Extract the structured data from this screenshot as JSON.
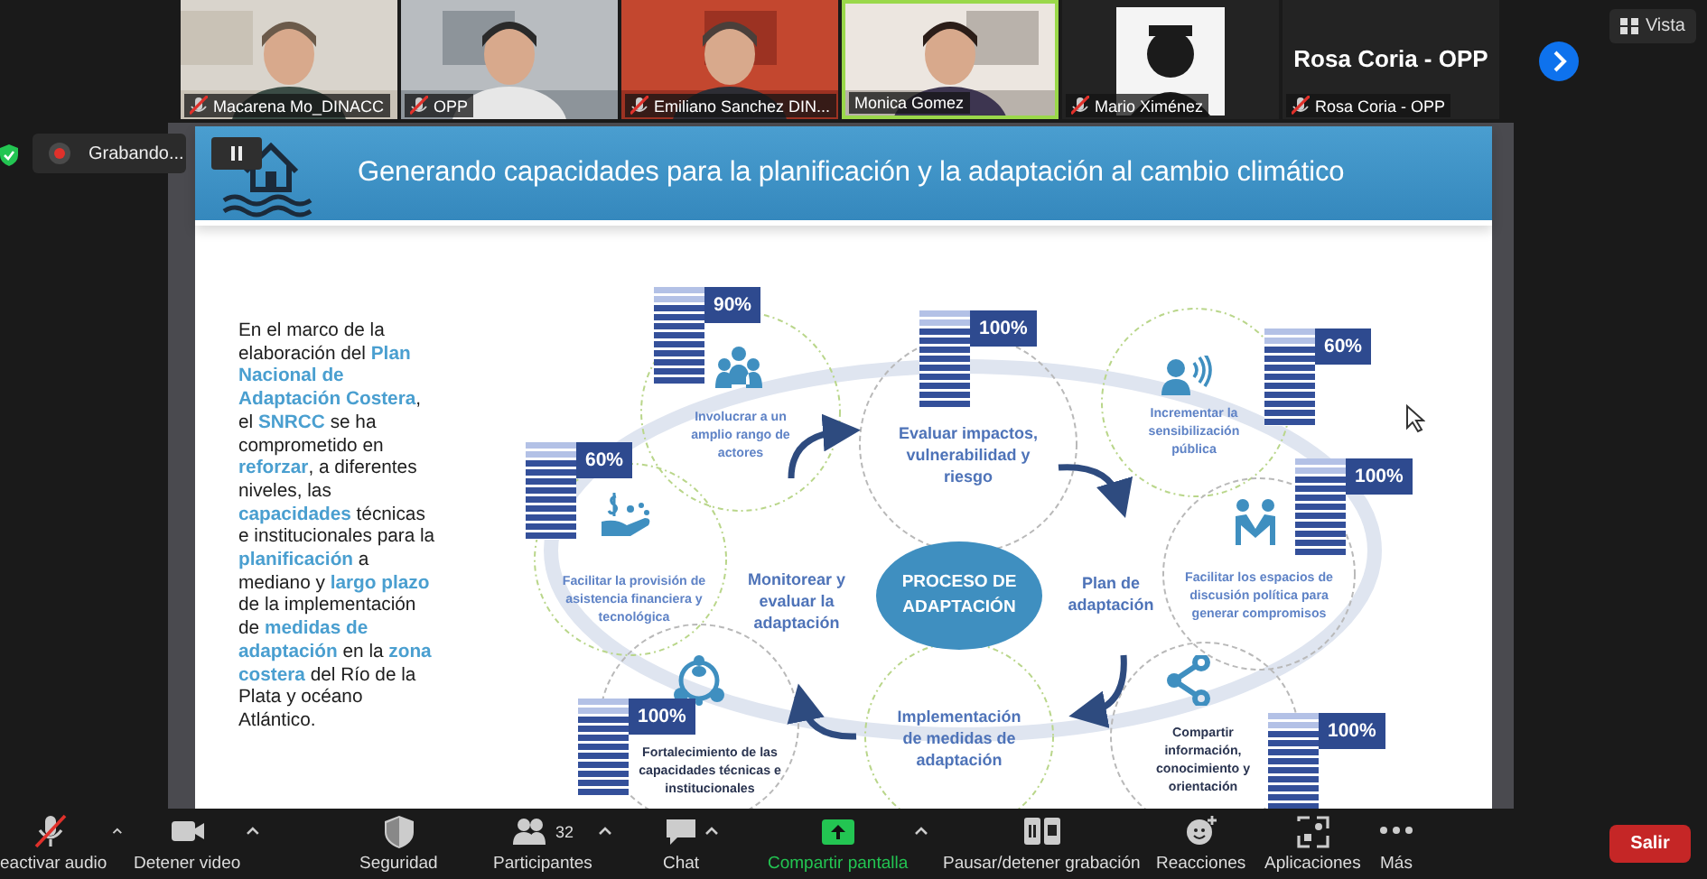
{
  "participants": [
    {
      "name": "Macarena Mo_DINACC",
      "kind": "video",
      "muted": true,
      "speaking": false
    },
    {
      "name": "OPP",
      "kind": "video",
      "muted": true,
      "speaking": false
    },
    {
      "name": "Emiliano Sanchez DIN...",
      "kind": "video",
      "muted": true,
      "speaking": false
    },
    {
      "name": "Monica Gomez",
      "kind": "video",
      "muted": false,
      "speaking": true
    },
    {
      "name": "Mario Ximénez",
      "kind": "avatar",
      "muted": true,
      "speaking": false
    },
    {
      "name": "Rosa Coria - OPP",
      "kind": "name",
      "display_name": "Rosa Coria - OPP",
      "muted": true,
      "speaking": false
    }
  ],
  "view_button": "Vista",
  "recording": {
    "label": "Grabando..."
  },
  "slide": {
    "title": "Generando capacidades para la planificación y la adaptación al cambio climático",
    "intro": "En el marco de la elaboración del **Plan Nacional de Adaptación Costera**, el **SNRCC** se ha comprometido en **reforzar**, a diferentes niveles, las **capacidades** técnicas e institucionales para la **planificación** a mediano y **largo plazo** de la implementación de **medidas de adaptación** en la **zona costera** del Río de la Plata y océano Atlántico.",
    "center": "PROCESO DE ADAPTACIÓN",
    "cycle_labels": [
      "Monitorear y evaluar la adaptación",
      "Plan de adaptación"
    ],
    "nodes": [
      {
        "label": "Involucrar a un amplio rango de actores",
        "kind": "group",
        "percent": "90%"
      },
      {
        "label": "Evaluar impactos, vulnerabilidad y riesgo",
        "percent": "100%"
      },
      {
        "label": "Incrementar la sensibilización pública",
        "kind": "speaker",
        "percent": "60%"
      },
      {
        "label": "Facilitar los espacios de discusión política para generar compromisos",
        "kind": "handshake",
        "percent": "100%"
      },
      {
        "label": "Compartir información, conocimiento y orientación",
        "kind": "share",
        "percent": "100%"
      },
      {
        "label": "Facilitar la provisión de asistencia financiera y tecnológica",
        "kind": "money",
        "percent": "60%"
      },
      {
        "label": "Fortalecimiento de las capacidades técnicas e institucionales",
        "kind": "team",
        "percent": "100%"
      },
      {
        "label": "Implementación de medidas de adaptación"
      }
    ]
  },
  "toolbar": [
    {
      "label": "eactivar audio",
      "kind": "mic",
      "muted": true,
      "menu": true
    },
    {
      "label": "Detener video",
      "kind": "camera",
      "menu": true
    },
    {
      "label": "Seguridad",
      "kind": "shield",
      "menu": false
    },
    {
      "label": "Participantes",
      "kind": "people",
      "count": "32",
      "menu": true
    },
    {
      "label": "Chat",
      "kind": "chat",
      "menu": true
    },
    {
      "label": "Compartir pantalla",
      "kind": "share",
      "menu": true
    },
    {
      "label": "Pausar/detener grabación",
      "kind": "record",
      "menu": false
    },
    {
      "label": "Reacciones",
      "kind": "reactions",
      "menu": false
    },
    {
      "label": "Aplicaciones",
      "kind": "apps",
      "menu": false
    },
    {
      "label": "Más",
      "kind": "more",
      "menu": false
    }
  ],
  "leave_button": "Salir"
}
